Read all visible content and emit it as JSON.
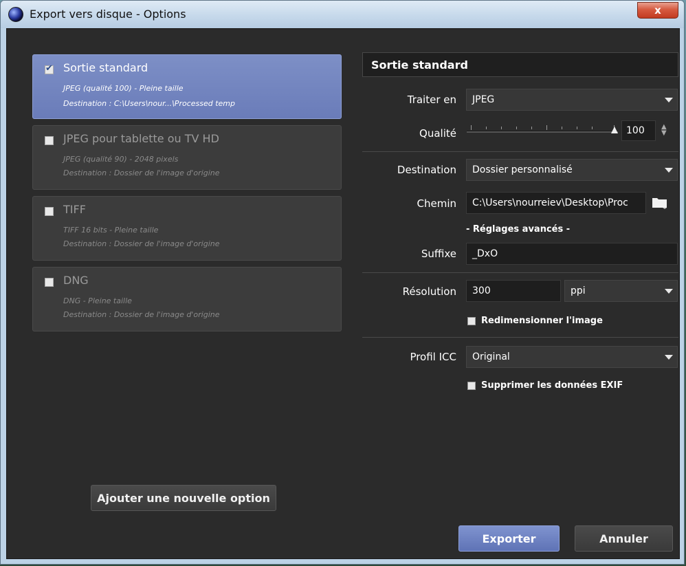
{
  "window": {
    "title": "Export vers disque - Options",
    "close_label": "x"
  },
  "options": [
    {
      "title": "Sortie standard",
      "line1": "JPEG (qualité 100)  -  Pleine taille",
      "line2": "Destination : C:\\Users\\nour...\\Processed temp",
      "checked": true
    },
    {
      "title": "JPEG pour tablette ou TV HD",
      "line1": "JPEG (qualité 90)  -  2048 pixels",
      "line2": "Destination : Dossier de l'image d'origine",
      "checked": false
    },
    {
      "title": "TIFF",
      "line1": "TIFF 16 bits  -  Pleine taille",
      "line2": "Destination : Dossier de l'image d'origine",
      "checked": false
    },
    {
      "title": "DNG",
      "line1": "DNG  -  Pleine taille",
      "line2": "Destination : Dossier de l'image d'origine",
      "checked": false
    }
  ],
  "add_option_label": "Ajouter une nouvelle option",
  "panel": {
    "header": "Sortie standard",
    "traiter_label": "Traiter en",
    "traiter_value": "JPEG",
    "qualite_label": "Qualité",
    "qualite_value": "100",
    "destination_label": "Destination",
    "destination_value": "Dossier personnalisé",
    "chemin_label": "Chemin",
    "chemin_value": "C:\\Users\\nourreiev\\Desktop\\Proc",
    "advanced_label": "- Réglages avancés -",
    "suffixe_label": "Suffixe",
    "suffixe_value": "_DxO",
    "resolution_label": "Résolution",
    "resolution_value": "300",
    "resolution_unit": "ppi",
    "resize_label": "Redimensionner l'image",
    "icc_label": "Profil ICC",
    "icc_value": "Original",
    "exif_label": "Supprimer les données EXIF"
  },
  "buttons": {
    "export": "Exporter",
    "cancel": "Annuler"
  },
  "colors": {
    "selected_card": "#7183c0",
    "primary_button": "#6e82c2",
    "close_button": "#d0503a"
  }
}
